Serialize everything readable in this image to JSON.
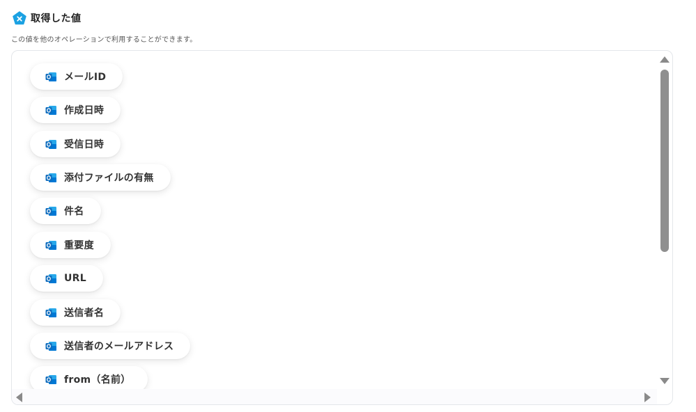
{
  "header": {
    "title": "取得した値",
    "icon": "yoom-pentagon-icon",
    "icon_color": "#1ba1e2",
    "subtitle": "この値を他のオペレーションで利用することができます。"
  },
  "outputs": {
    "item_icon": "outlook-icon",
    "item_icon_color": "#0f6cbd",
    "items": [
      {
        "label": "メールID"
      },
      {
        "label": "作成日時"
      },
      {
        "label": "受信日時"
      },
      {
        "label": "添付ファイルの有無"
      },
      {
        "label": "件名"
      },
      {
        "label": "重要度"
      },
      {
        "label": "URL"
      },
      {
        "label": "送信者名"
      },
      {
        "label": "送信者のメールアドレス"
      },
      {
        "label": "from（名前）"
      }
    ]
  }
}
